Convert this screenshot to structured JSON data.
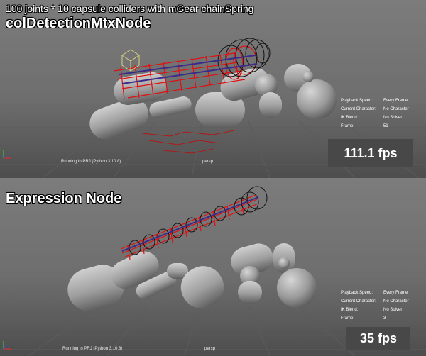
{
  "caption": "100 joints * 10 capsule colliders with mGear chainSpring",
  "panels": [
    {
      "title": "colDetectionMtxNode",
      "hud": {
        "playback_speed_label": "Playback Speed:",
        "playback_speed_value": "Every Frame",
        "current_character_label": "Current Character:",
        "current_character_value": "No Character",
        "ik_blend_label": "IK Blend:",
        "ik_blend_value": "No Solver",
        "frame_label": "Frame:",
        "frame_value": "51"
      },
      "status": "Running in PRJ (Python 3.10.8)",
      "camera": "persp",
      "fps": "111.1 fps"
    },
    {
      "title": "Expression Node",
      "hud": {
        "playback_speed_label": "Playback Speed:",
        "playback_speed_value": "Every Frame",
        "current_character_label": "Current Character:",
        "current_character_value": "No Character",
        "ik_blend_label": "IK Blend:",
        "ik_blend_value": "No Solver",
        "frame_label": "Frame:",
        "frame_value": "3"
      },
      "status": "Running in PRJ (Python 3.10.8)",
      "camera": "persp",
      "fps": "35 fps"
    }
  ],
  "colors": {
    "collider_chain": "#e01010",
    "joint_chain": "#3a2a8a",
    "capsule": "#b5b5b5",
    "grid": "#5a5a5a"
  }
}
